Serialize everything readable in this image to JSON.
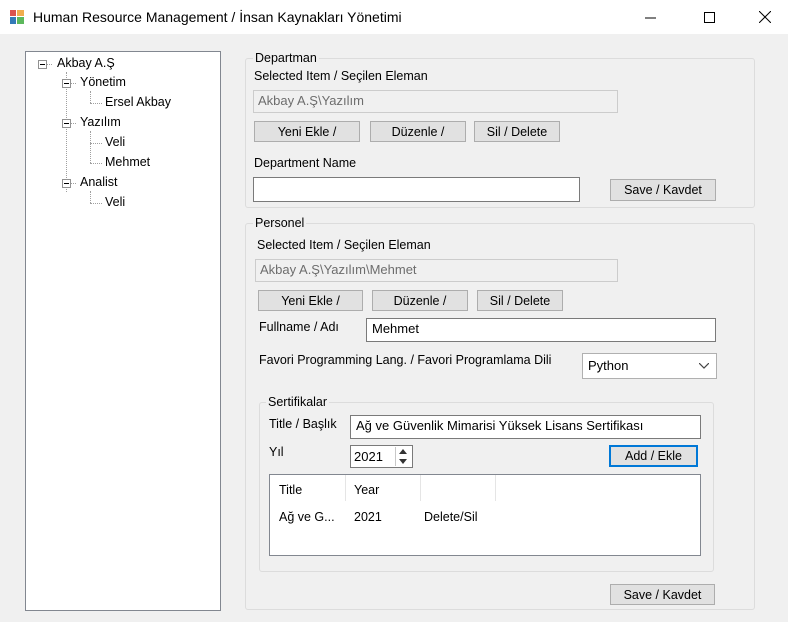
{
  "window": {
    "title": "Human Resource Management / İnsan Kaynakları Yönetimi",
    "minimize_glyph": "—",
    "maximize_glyph": "☐",
    "close_glyph": "✕"
  },
  "tree": {
    "root": "Akbay A.Ş",
    "groups": [
      {
        "label": "Yönetim",
        "children": [
          "Ersel Akbay"
        ]
      },
      {
        "label": "Yazılım",
        "children": [
          "Veli",
          "Mehmet"
        ]
      },
      {
        "label": "Analist",
        "children": [
          "Veli"
        ]
      }
    ]
  },
  "departman": {
    "legend": "Departman",
    "selected_label": "Selected Item / Seçilen Eleman",
    "selected_value": "Akbay A.Ş\\Yazılım",
    "add_button": "Yeni Ekle /",
    "edit_button": "Düzenle /",
    "delete_button": "Sil / Delete",
    "name_label": "Department Name",
    "name_value": "",
    "save_button": "Save / Kavdet"
  },
  "personel": {
    "legend": "Personel",
    "selected_label": "Selected Item / Seçilen Eleman",
    "selected_value": "Akbay A.Ş\\Yazılım\\Mehmet",
    "add_button": "Yeni Ekle /",
    "edit_button": "Düzenle /",
    "delete_button": "Sil / Delete",
    "fullname_label": "Fullname / Adı",
    "fullname_value": "Mehmet",
    "lang_label": "Favori Programming Lang. / Favori Programlama Dili",
    "lang_value": "Python",
    "save_button": "Save / Kavdet"
  },
  "sertifikalar": {
    "legend": "Sertifikalar",
    "title_label": "Title / Başlık",
    "title_value": "Ağ ve Güvenlik Mimarisi Yüksek Lisans Sertifikası",
    "year_label": "Yıl",
    "year_value": "2021",
    "add_button": "Add / Ekle",
    "columns": [
      "Title",
      "Year"
    ],
    "rows": [
      {
        "title": "Ağ ve G...",
        "year": "2021",
        "action": "Delete/Sil"
      }
    ]
  }
}
